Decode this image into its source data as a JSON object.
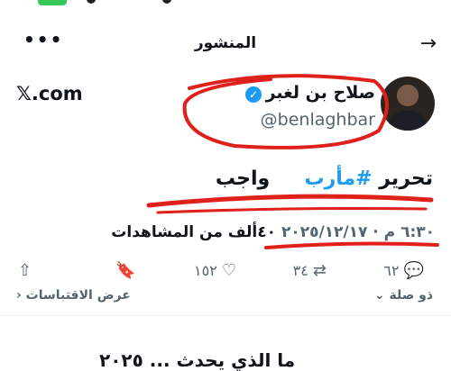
{
  "header": {
    "title": "المنشور",
    "back_icon": "→",
    "more_icon": "•••"
  },
  "author": {
    "display_name": "صلاح بن لغبر",
    "handle": "@benlaghbar",
    "verified_icon": "✓",
    "site": "𝕏.com"
  },
  "tweet": {
    "word1": "تحرير",
    "hashtag": "#مأرب",
    "word2": "واجب"
  },
  "meta": {
    "datetime": "٦:٣٠ م · ٢٠٢٥/١٢/١٧",
    "views_count": "٤٠ألف",
    "views_label": "من المشاهدات"
  },
  "actions": {
    "reply_count": "٦٢",
    "retweet_count": "٣٤",
    "like_count": "١٥٢",
    "reply_icon": "💬",
    "retweet_icon": "⇄",
    "like_icon": "♡",
    "bookmark_icon": "🔖",
    "share_icon": "⇧"
  },
  "footer": {
    "reply_to_label": "ذو صلة",
    "quotes_label": "عرض الاقتباسات",
    "peek_text": "ما الذي يحدث ... ٢٠٢٥"
  },
  "colors": {
    "accent": "#1d9bf0",
    "annotation": "#e0201b",
    "muted": "#536471"
  }
}
